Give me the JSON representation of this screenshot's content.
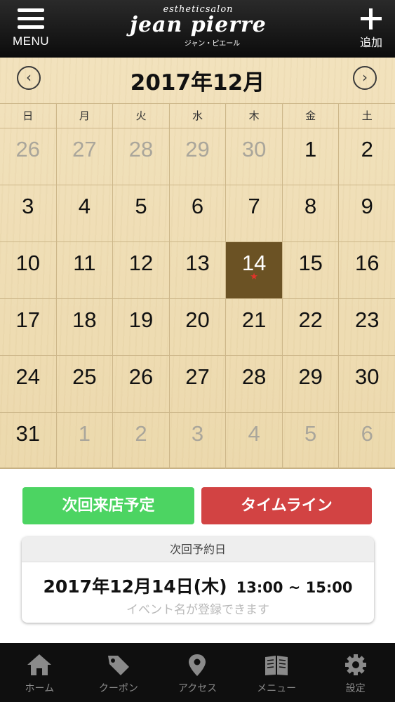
{
  "header": {
    "menu_label": "MENU",
    "brand_small": "estheticsalon",
    "brand_main": "jean pierre",
    "brand_kana": "ジャン・ピエール",
    "add_label": "追加"
  },
  "calendar": {
    "month_title": "2017年12月",
    "prev_icon": "‹",
    "next_icon": "›",
    "weekdays": [
      "日",
      "月",
      "火",
      "水",
      "木",
      "金",
      "土"
    ],
    "weeks": [
      [
        {
          "d": "26",
          "m": true
        },
        {
          "d": "27",
          "m": true
        },
        {
          "d": "28",
          "m": true
        },
        {
          "d": "29",
          "m": true
        },
        {
          "d": "30",
          "m": true
        },
        {
          "d": "1"
        },
        {
          "d": "2"
        }
      ],
      [
        {
          "d": "3"
        },
        {
          "d": "4"
        },
        {
          "d": "5"
        },
        {
          "d": "6"
        },
        {
          "d": "7"
        },
        {
          "d": "8"
        },
        {
          "d": "9"
        }
      ],
      [
        {
          "d": "10"
        },
        {
          "d": "11"
        },
        {
          "d": "12"
        },
        {
          "d": "13"
        },
        {
          "d": "14",
          "today": true,
          "star": true
        },
        {
          "d": "15"
        },
        {
          "d": "16"
        }
      ],
      [
        {
          "d": "17"
        },
        {
          "d": "18"
        },
        {
          "d": "19"
        },
        {
          "d": "20"
        },
        {
          "d": "21"
        },
        {
          "d": "22"
        },
        {
          "d": "23"
        }
      ],
      [
        {
          "d": "24"
        },
        {
          "d": "25"
        },
        {
          "d": "26"
        },
        {
          "d": "27"
        },
        {
          "d": "28"
        },
        {
          "d": "29"
        },
        {
          "d": "30"
        }
      ],
      [
        {
          "d": "31"
        },
        {
          "d": "1",
          "m": true
        },
        {
          "d": "2",
          "m": true
        },
        {
          "d": "3",
          "m": true
        },
        {
          "d": "4",
          "m": true
        },
        {
          "d": "5",
          "m": true
        },
        {
          "d": "6",
          "m": true
        }
      ]
    ],
    "star_glyph": "★",
    "colors": {
      "today_bg": "#6b5224",
      "star": "#e3332a",
      "muted": "#aaa69b"
    }
  },
  "actions": {
    "next_visit_label": "次回来店予定",
    "timeline_label": "タイムライン",
    "colors": {
      "next_visit": "#4cd462",
      "timeline": "#d24343"
    }
  },
  "next_appointment": {
    "heading": "次回予約日",
    "date": "2017年12月14日(木)",
    "time": "13:00 ~ 15:00",
    "event_placeholder": "イベント名が登録できます"
  },
  "tabbar": {
    "items": [
      {
        "label": "ホーム",
        "icon": "home-icon"
      },
      {
        "label": "クーポン",
        "icon": "tag-icon"
      },
      {
        "label": "アクセス",
        "icon": "map-pin-icon"
      },
      {
        "label": "メニュー",
        "icon": "book-icon"
      },
      {
        "label": "設定",
        "icon": "gear-icon"
      }
    ]
  }
}
